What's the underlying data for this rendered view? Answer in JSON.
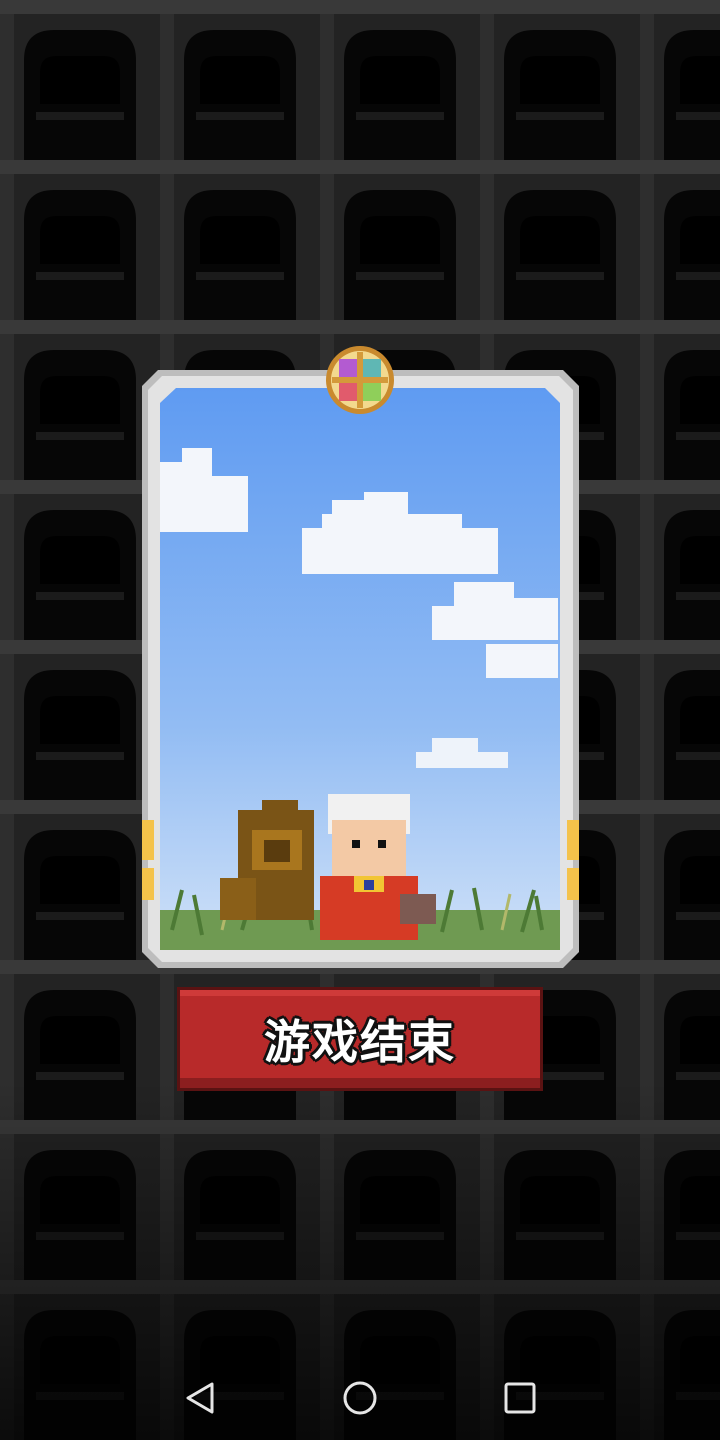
{
  "game_over": {
    "label": "游戏结束"
  },
  "nav": {
    "back": "back-icon",
    "home": "home-icon",
    "recents": "recents-icon"
  },
  "colors": {
    "button_red": "#b82a2a",
    "sky_top": "#5f9bf2",
    "sky_bottom": "#c7dcf7",
    "frame": "#dcdcdc",
    "background": "#141414"
  }
}
